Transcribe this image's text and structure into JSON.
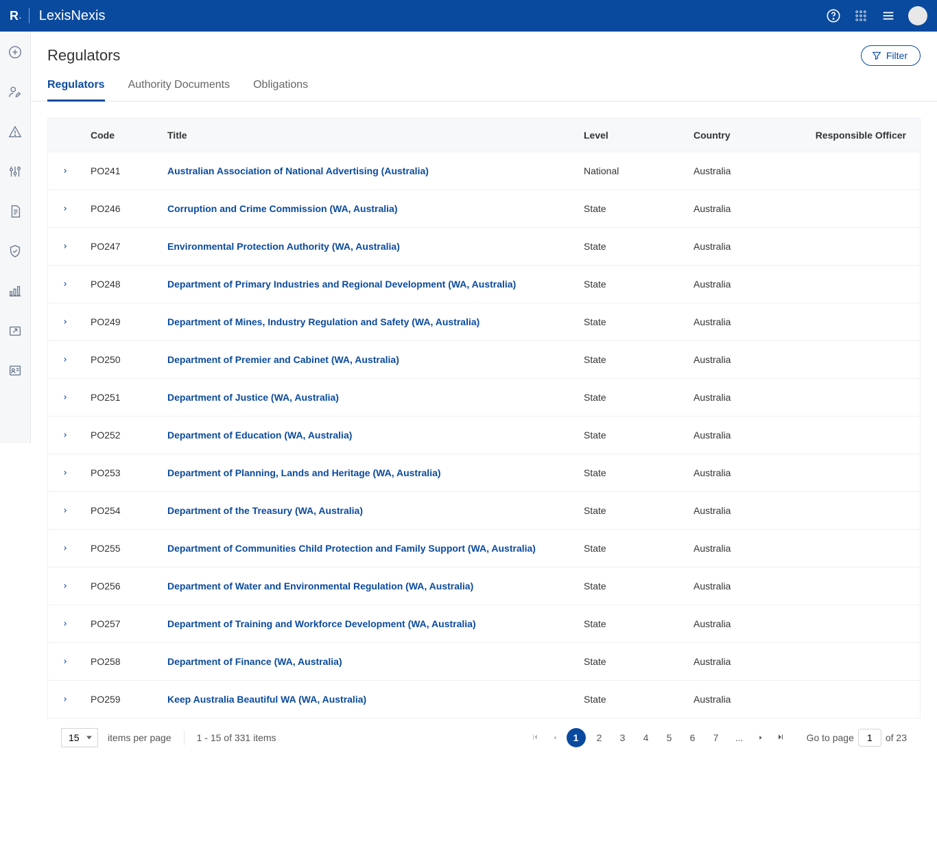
{
  "header": {
    "logo": "R",
    "brand": "LexisNexis"
  },
  "page": {
    "title": "Regulators",
    "filter_label": "Filter"
  },
  "tabs": [
    {
      "label": "Regulators",
      "active": true
    },
    {
      "label": "Authority Documents",
      "active": false
    },
    {
      "label": "Obligations",
      "active": false
    }
  ],
  "columns": {
    "code": "Code",
    "title": "Title",
    "level": "Level",
    "country": "Country",
    "officer": "Responsible Officer"
  },
  "rows": [
    {
      "code": "PO241",
      "title": "Australian Association of National Advertising (Australia)",
      "level": "National",
      "country": "Australia",
      "officer": ""
    },
    {
      "code": "PO246",
      "title": "Corruption and Crime Commission (WA, Australia)",
      "level": "State",
      "country": "Australia",
      "officer": ""
    },
    {
      "code": "PO247",
      "title": "Environmental Protection Authority (WA, Australia)",
      "level": "State",
      "country": "Australia",
      "officer": ""
    },
    {
      "code": "PO248",
      "title": "Department of Primary Industries and Regional Development (WA, Australia)",
      "level": "State",
      "country": "Australia",
      "officer": ""
    },
    {
      "code": "PO249",
      "title": "Department of Mines, Industry Regulation and Safety (WA, Australia)",
      "level": "State",
      "country": "Australia",
      "officer": ""
    },
    {
      "code": "PO250",
      "title": "Department of Premier and Cabinet (WA, Australia)",
      "level": "State",
      "country": "Australia",
      "officer": ""
    },
    {
      "code": "PO251",
      "title": "Department of Justice (WA, Australia)",
      "level": "State",
      "country": "Australia",
      "officer": ""
    },
    {
      "code": "PO252",
      "title": "Department of Education (WA, Australia)",
      "level": "State",
      "country": "Australia",
      "officer": ""
    },
    {
      "code": "PO253",
      "title": "Department of Planning, Lands and Heritage (WA, Australia)",
      "level": "State",
      "country": "Australia",
      "officer": ""
    },
    {
      "code": "PO254",
      "title": "Department of the Treasury (WA, Australia)",
      "level": "State",
      "country": "Australia",
      "officer": ""
    },
    {
      "code": "PO255",
      "title": "Department of Communities Child Protection and Family Support (WA, Australia)",
      "level": "State",
      "country": "Australia",
      "officer": ""
    },
    {
      "code": "PO256",
      "title": "Department of Water and Environmental Regulation (WA, Australia)",
      "level": "State",
      "country": "Australia",
      "officer": ""
    },
    {
      "code": "PO257",
      "title": "Department of Training and Workforce Development (WA, Australia)",
      "level": "State",
      "country": "Australia",
      "officer": ""
    },
    {
      "code": "PO258",
      "title": "Department of Finance (WA, Australia)",
      "level": "State",
      "country": "Australia",
      "officer": ""
    },
    {
      "code": "PO259",
      "title": "Keep Australia Beautiful WA (WA, Australia)",
      "level": "State",
      "country": "Australia",
      "officer": ""
    }
  ],
  "pagination": {
    "page_size": "15",
    "items_per_page_label": "items per page",
    "range_text": "1 - 15 of 331 items",
    "pages": [
      "1",
      "2",
      "3",
      "4",
      "5",
      "6",
      "7",
      "..."
    ],
    "current_page": "1",
    "goto_label": "Go to page",
    "goto_value": "1",
    "total_pages_label": "of 23"
  }
}
